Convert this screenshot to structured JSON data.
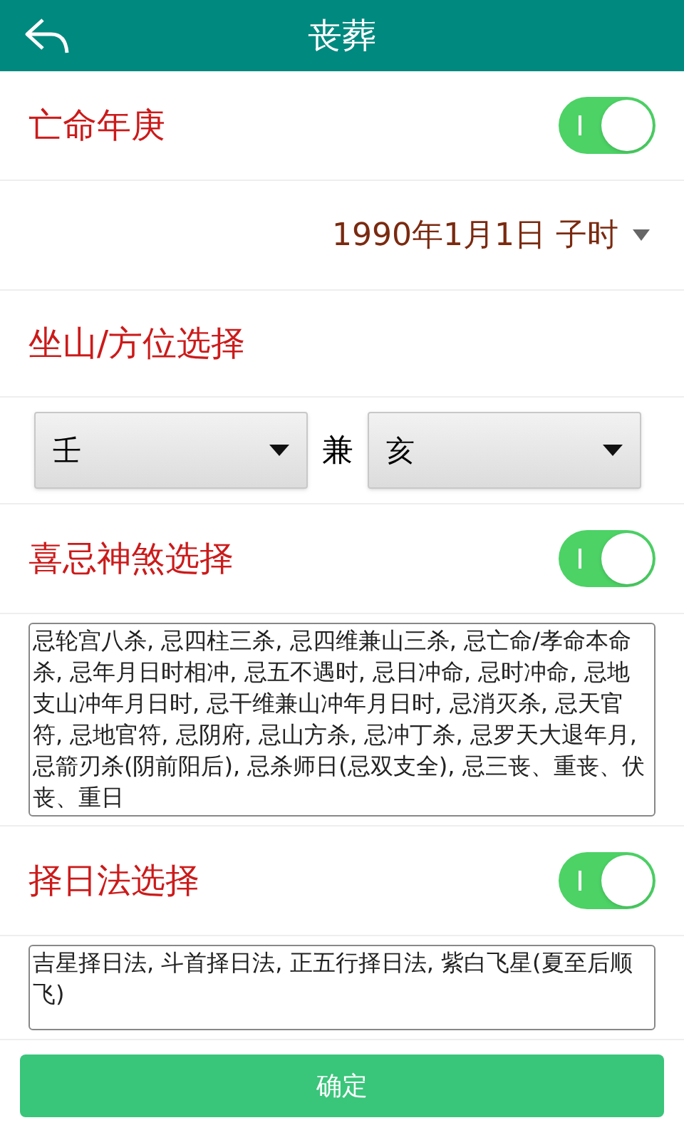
{
  "header": {
    "title": "丧葬"
  },
  "rows": [
    {
      "kind": "toggle",
      "label": "亡命年庚",
      "on": true
    },
    {
      "kind": "date",
      "value": "1990年1月1日 子时"
    },
    {
      "kind": "heading",
      "label": "坐山/方位选择"
    },
    {
      "kind": "selects",
      "first": "壬",
      "joiner": "兼",
      "second": "亥"
    },
    {
      "kind": "toggle",
      "label": "喜忌神煞选择",
      "on": true
    },
    {
      "kind": "textbox",
      "text": "忌轮宫八杀, 忌四柱三杀, 忌四维兼山三杀, 忌亡命/孝命本命杀, 忌年月日时相冲, 忌五不遇时, 忌日冲命, 忌时冲命, 忌地支山冲年月日时, 忌干维兼山冲年月日时, 忌消灭杀, 忌天官符, 忌地官符, 忌阴府, 忌山方杀, 忌冲丁杀, 忌罗天大退年月, 忌箭刃杀(阴前阳后), 忌杀师日(忌双支全), 忌三丧、重丧、伏丧、重日"
    },
    {
      "kind": "toggle",
      "label": "择日法选择",
      "on": true
    },
    {
      "kind": "textbox",
      "text": "吉星择日法, 斗首择日法, 正五行择日法, 紫白飞星(夏至后顺飞)"
    }
  ],
  "confirm_button": "确定"
}
